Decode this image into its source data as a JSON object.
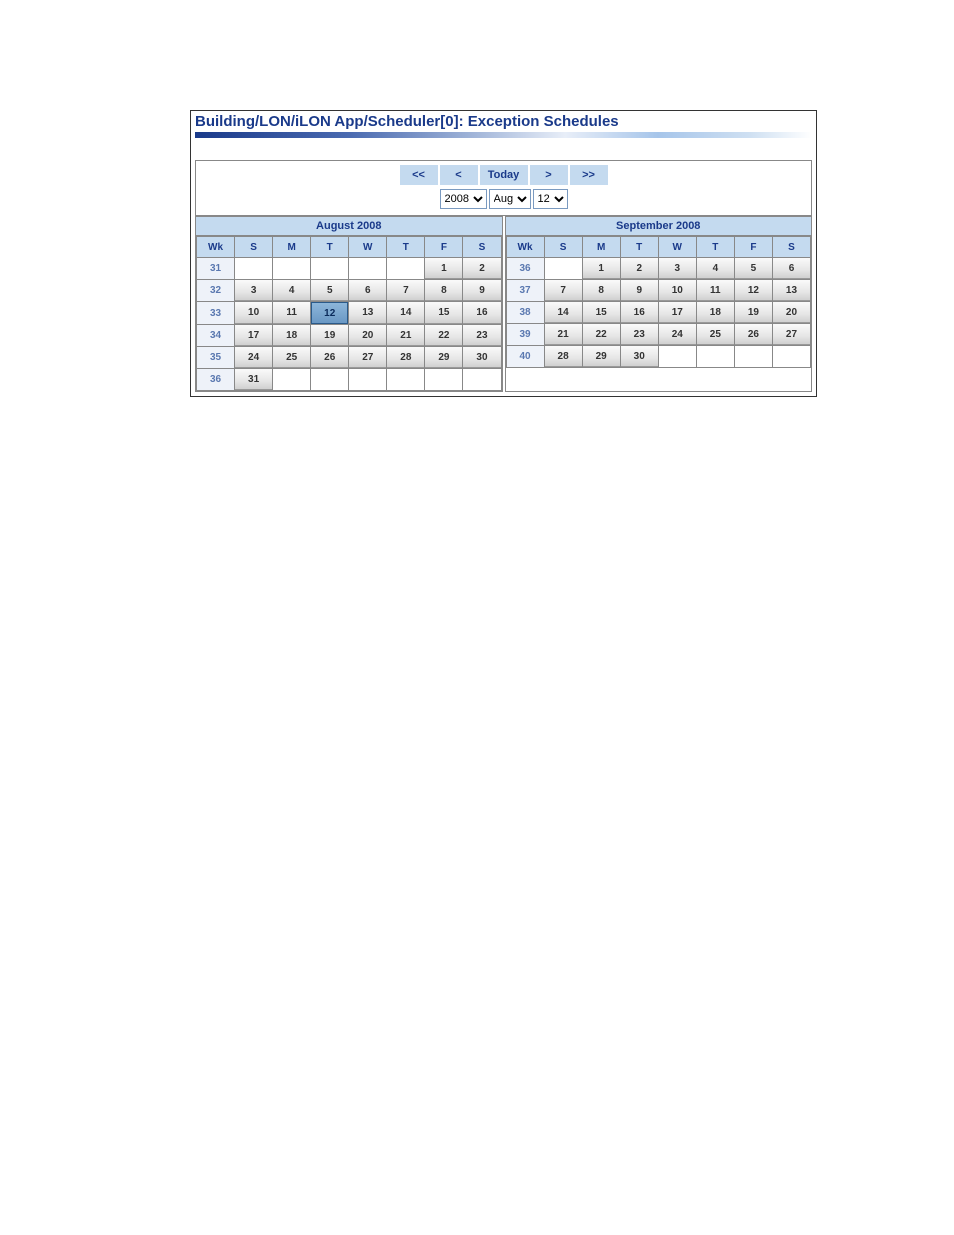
{
  "title": "Building/LON/iLON App/Scheduler[0]: Exception Schedules",
  "nav": {
    "prev_far": "<<",
    "prev": "<",
    "today": "Today",
    "next": ">",
    "next_far": ">>",
    "year_selected": "2008",
    "month_selected": "Aug",
    "day_selected": "12"
  },
  "day_headers": [
    "Wk",
    "S",
    "M",
    "T",
    "W",
    "T",
    "F",
    "S"
  ],
  "calendars": [
    {
      "title": "August 2008",
      "selected_day": 12,
      "weeks": [
        {
          "wk": 31,
          "days": [
            "",
            "",
            "",
            "",
            "",
            1,
            2
          ]
        },
        {
          "wk": 32,
          "days": [
            3,
            4,
            5,
            6,
            7,
            8,
            9
          ]
        },
        {
          "wk": 33,
          "days": [
            10,
            11,
            12,
            13,
            14,
            15,
            16
          ]
        },
        {
          "wk": 34,
          "days": [
            17,
            18,
            19,
            20,
            21,
            22,
            23
          ]
        },
        {
          "wk": 35,
          "days": [
            24,
            25,
            26,
            27,
            28,
            29,
            30
          ]
        },
        {
          "wk": 36,
          "days": [
            31,
            "",
            "",
            "",
            "",
            "",
            ""
          ]
        }
      ]
    },
    {
      "title": "September 2008",
      "selected_day": null,
      "weeks": [
        {
          "wk": 36,
          "days": [
            "",
            1,
            2,
            3,
            4,
            5,
            6
          ]
        },
        {
          "wk": 37,
          "days": [
            7,
            8,
            9,
            10,
            11,
            12,
            13
          ]
        },
        {
          "wk": 38,
          "days": [
            14,
            15,
            16,
            17,
            18,
            19,
            20
          ]
        },
        {
          "wk": 39,
          "days": [
            21,
            22,
            23,
            24,
            25,
            26,
            27
          ]
        },
        {
          "wk": 40,
          "days": [
            28,
            29,
            30,
            "",
            "",
            "",
            ""
          ]
        }
      ]
    }
  ]
}
